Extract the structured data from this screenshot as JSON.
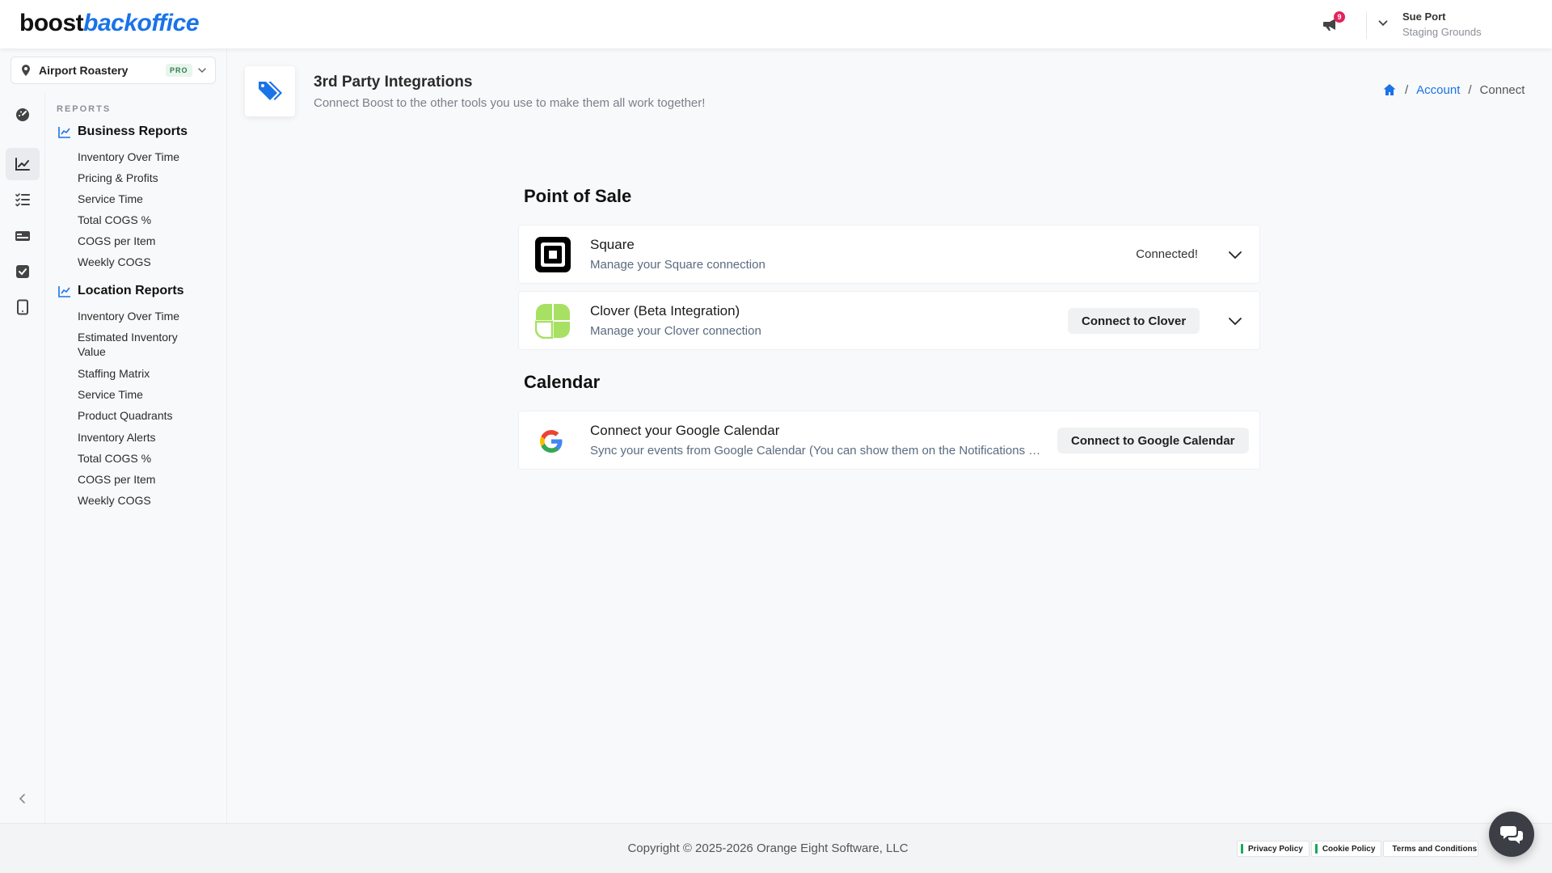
{
  "header": {
    "logo_primary": "boost",
    "logo_secondary": "backoffice",
    "notification_count": "9",
    "user_name": "Sue Port",
    "user_org": "Staging Grounds"
  },
  "location": {
    "name": "Airport Roastery",
    "badge": "PRO"
  },
  "nav": {
    "section_label": "REPORTS",
    "business": {
      "title": "Business Reports",
      "items": [
        "Inventory Over Time",
        "Pricing & Profits",
        "Service Time",
        "Total COGS %",
        "COGS per Item",
        "Weekly COGS"
      ]
    },
    "location": {
      "title": "Location Reports",
      "items": [
        "Inventory Over Time",
        "Estimated Inventory Value",
        "Staffing Matrix",
        "Service Time",
        "Product Quadrants",
        "Inventory Alerts",
        "Total COGS %",
        "COGS per Item",
        "Weekly COGS"
      ]
    }
  },
  "page": {
    "title": "3rd Party Integrations",
    "subtitle": "Connect Boost to the other tools you use to make them all work together!",
    "breadcrumb": {
      "account": "Account",
      "current": "Connect"
    }
  },
  "sections": {
    "pos_heading": "Point of Sale",
    "calendar_heading": "Calendar"
  },
  "integrations": {
    "square": {
      "name": "Square",
      "description": "Manage your Square connection",
      "status": "Connected!"
    },
    "clover": {
      "name": "Clover (Beta Integration)",
      "description": "Manage your Clover connection",
      "button": "Connect to Clover"
    },
    "google": {
      "name": "Connect your Google Calendar",
      "description": "Sync your events from Google Calendar (You can show them on the Notifications screen)",
      "button": "Connect to Google Calendar"
    }
  },
  "footer": {
    "copyright": "Copyright © 2025-2026 Orange Eight Software, LLC",
    "links": [
      "Privacy Policy",
      "Cookie Policy",
      "Terms and Conditions"
    ]
  },
  "colors": {
    "accent": "#1a73e8",
    "clover_green": "#a8e063",
    "badge_red": "#e0245e"
  }
}
